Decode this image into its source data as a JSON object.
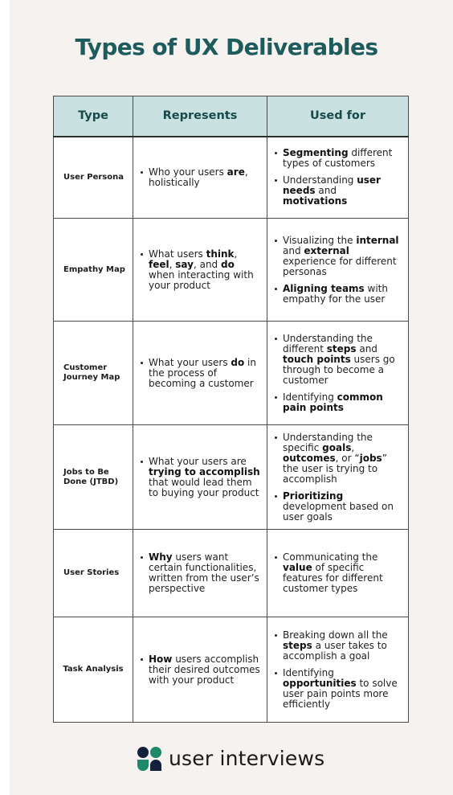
{
  "title": "Types of UX Deliverables",
  "table": {
    "headers": [
      "Type",
      "Represents",
      "Used for"
    ],
    "rows": [
      {
        "type": "User Persona",
        "represents": [
          [
            {
              "t": "Who your users "
            },
            {
              "t": "are",
              "b": true
            },
            {
              "t": ", holistically"
            }
          ]
        ],
        "used_for": [
          [
            {
              "t": "Segmenting",
              "b": true
            },
            {
              "t": " different types of customers"
            }
          ],
          [
            {
              "t": "Understanding "
            },
            {
              "t": "user needs",
              "b": true
            },
            {
              "t": " and "
            },
            {
              "t": "motivations",
              "b": true
            }
          ]
        ]
      },
      {
        "type": "Empathy Map",
        "represents": [
          [
            {
              "t": "What users "
            },
            {
              "t": "think",
              "b": true
            },
            {
              "t": ", "
            },
            {
              "t": "feel",
              "b": true
            },
            {
              "t": ", "
            },
            {
              "t": "say",
              "b": true
            },
            {
              "t": ", and "
            },
            {
              "t": "do",
              "b": true
            },
            {
              "t": " when interacting with your product"
            }
          ]
        ],
        "used_for": [
          [
            {
              "t": "Visualizing the "
            },
            {
              "t": "internal",
              "b": true
            },
            {
              "t": " and "
            },
            {
              "t": "external",
              "b": true
            },
            {
              "t": " experience for different personas"
            }
          ],
          [
            {
              "t": "Aligning teams",
              "b": true
            },
            {
              "t": " with empathy for the user"
            }
          ]
        ]
      },
      {
        "type": "Customer Journey Map",
        "represents": [
          [
            {
              "t": "What your users "
            },
            {
              "t": "do",
              "b": true
            },
            {
              "t": " in the process of becoming a customer"
            }
          ]
        ],
        "used_for": [
          [
            {
              "t": "Understanding the different "
            },
            {
              "t": "steps",
              "b": true
            },
            {
              "t": " and "
            },
            {
              "t": "touch points",
              "b": true
            },
            {
              "t": " users go through to become a customer"
            }
          ],
          [
            {
              "t": "Identifying "
            },
            {
              "t": "common pain points",
              "b": true
            }
          ]
        ]
      },
      {
        "type": "Jobs to Be Done (JTBD)",
        "represents": [
          [
            {
              "t": "What your users are "
            },
            {
              "t": "trying to accomplish",
              "b": true
            },
            {
              "t": " that would lead them to buying your product"
            }
          ]
        ],
        "used_for": [
          [
            {
              "t": "Understanding the specific "
            },
            {
              "t": "goals",
              "b": true
            },
            {
              "t": ", "
            },
            {
              "t": "outcomes",
              "b": true
            },
            {
              "t": ", or “"
            },
            {
              "t": "jobs",
              "b": true
            },
            {
              "t": "” the user is trying to accomplish"
            }
          ],
          [
            {
              "t": "Prioritizing",
              "b": true
            },
            {
              "t": " development based on user goals"
            }
          ]
        ]
      },
      {
        "type": "User Stories",
        "represents": [
          [
            {
              "t": "Why",
              "b": true
            },
            {
              "t": " users want certain functionalities, written from the user’s perspective"
            }
          ]
        ],
        "used_for": [
          [
            {
              "t": "Communicating the "
            },
            {
              "t": "value",
              "b": true
            },
            {
              "t": " of specific features for different customer types"
            }
          ]
        ]
      },
      {
        "type": "Task Analysis",
        "represents": [
          [
            {
              "t": "How",
              "b": true
            },
            {
              "t": " users accomplish their desired outcomes with your product"
            }
          ]
        ],
        "used_for": [
          [
            {
              "t": "Breaking down all the "
            },
            {
              "t": "steps",
              "b": true
            },
            {
              "t": " a user takes to accomplish a goal"
            }
          ],
          [
            {
              "t": "Identifying "
            },
            {
              "t": "opportunities",
              "b": true
            },
            {
              "t": " to solve user pain points more efficiently"
            }
          ]
        ]
      }
    ]
  },
  "logo": {
    "icon": "user-interviews-logo-icon",
    "text": "user interviews"
  },
  "colors": {
    "title": "#1e5b5d",
    "header_bg": "#c9e1e0",
    "header_text": "#184a4b",
    "background": "#f5f2ef",
    "logo_navy": "#14213d",
    "logo_teal": "#1f8a6b"
  }
}
